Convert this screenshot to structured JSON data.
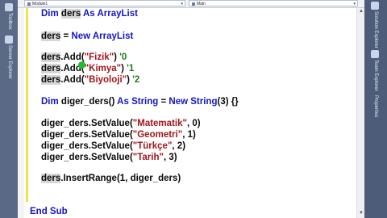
{
  "topbar": {
    "left_dropdown": "Module1",
    "right_dropdown": "Main"
  },
  "sidebars": {
    "left_labels": [
      "Toolbox",
      "Server Explorer"
    ],
    "right_labels": [
      "Solution Explorer",
      "Team Explorer",
      "Properties"
    ]
  },
  "code": {
    "l1": {
      "kw1": "Dim ",
      "id1": "ders",
      "kw2": " As ",
      "type": "ArrayList"
    },
    "l2": {
      "id1": "ders",
      "op": " = ",
      "kw1": "New ",
      "type": "ArrayList"
    },
    "l3": {
      "id1": "ders",
      "call": ".Add(",
      "str": "\"Fizik\"",
      "close": ") ",
      "cmt": "'0"
    },
    "l4": {
      "id1": "ders",
      "call": ".Add(",
      "str": "\"Kimya\"",
      "close": ") ",
      "cmt": "'1"
    },
    "l5": {
      "id1": "ders",
      "call": ".Add(",
      "str": "\"Biyoloji\"",
      "close": ") ",
      "cmt": "'2"
    },
    "l6": {
      "kw1": "Dim ",
      "id1": "diger_ders() ",
      "kw2": "As ",
      "kw3": "String",
      "op": " = ",
      "kw4": "New ",
      "kw5": "String",
      "rest": "(3) {}"
    },
    "l7": {
      "id1": "diger_ders.SetValue(",
      "str": "\"Matematik\"",
      "rest": ", 0)"
    },
    "l8": {
      "id1": "diger_ders.SetValue(",
      "str": "\"Geometri\"",
      "rest": ", 1)"
    },
    "l9": {
      "id1": "diger_ders.SetValue(",
      "str": "\"Türkçe\"",
      "rest": ", 2)"
    },
    "l10": {
      "id1": "diger_ders.SetValue(",
      "str": "\"Tarih\"",
      "rest": ", 3)"
    },
    "l11": {
      "id1": "ders",
      "rest": ".InsertRange(1, diger_ders)"
    },
    "l12": {
      "kw1": "End Sub"
    }
  },
  "colors": {
    "keyword": "#1515c8",
    "string": "#a3151b",
    "comment": "#1e7d1e",
    "change_margin": "#f2e24a",
    "cursor_marker": "#1fbf2a"
  }
}
